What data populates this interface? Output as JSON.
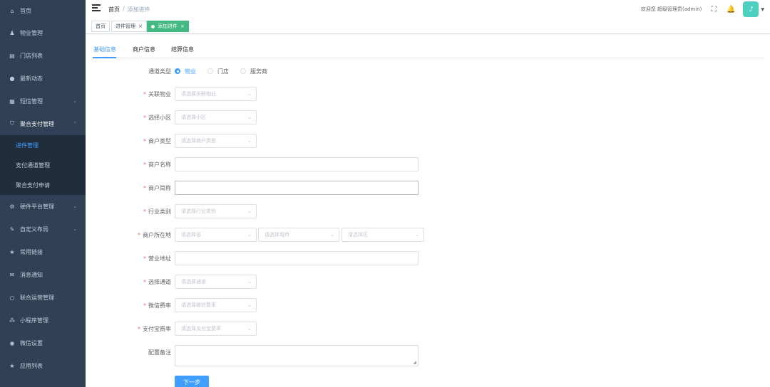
{
  "sidebar": {
    "items": [
      {
        "label": "首页",
        "icon": "dashboard-icon",
        "glyph": "⌂"
      },
      {
        "label": "物业管理",
        "icon": "user-icon",
        "glyph": "♟"
      },
      {
        "label": "门店列表",
        "icon": "store-icon",
        "glyph": "▤"
      },
      {
        "label": "最新动态",
        "icon": "chat-icon",
        "glyph": "●"
      },
      {
        "label": "短信管理",
        "icon": "grid-icon",
        "glyph": "▦"
      },
      {
        "label": "聚合支付管理",
        "icon": "shield-icon",
        "glyph": "⛉"
      },
      {
        "label": "进件管理"
      },
      {
        "label": "支付通道管理"
      },
      {
        "label": "聚合支付申请"
      },
      {
        "label": "硬件平台管理",
        "icon": "gear-icon",
        "glyph": "⚙"
      },
      {
        "label": "自定义布局",
        "icon": "edit-icon",
        "glyph": "✎"
      },
      {
        "label": "常用链接",
        "icon": "star-icon",
        "glyph": "★"
      },
      {
        "label": "消息通知",
        "icon": "message-icon",
        "glyph": "✉"
      },
      {
        "label": "联合运营管理",
        "icon": "bulb-icon",
        "glyph": "○"
      },
      {
        "label": "小程序管理",
        "icon": "cluster-icon",
        "glyph": "⁂"
      },
      {
        "label": "微信设置",
        "icon": "wechat-icon",
        "glyph": "◉"
      },
      {
        "label": "应用列表",
        "icon": "star-icon",
        "glyph": "★"
      }
    ]
  },
  "header": {
    "breadcrumb_home": "首页",
    "breadcrumb_sep": "/",
    "breadcrumb_current": "添加进件",
    "welcome": "欢迎您 超级管理员(admin)",
    "avatar_glyph": "♪",
    "caret": "▼"
  },
  "tags": {
    "home": "首页",
    "jinjian": "进件管理",
    "add": "添加进件",
    "close": "×"
  },
  "tabs": [
    "基础信息",
    "商户信息",
    "结算信息"
  ],
  "form": {
    "channel_type_label": "通道类型",
    "channel_options": [
      "物业",
      "门店",
      "服务商"
    ],
    "related_property_label": "关联物业",
    "related_property_placeholder": "请选择关联物业",
    "community_label": "选择小区",
    "community_placeholder": "请选择小区",
    "merchant_type_label": "商户类型",
    "merchant_type_placeholder": "请选择商户类型",
    "merchant_name_label": "商户名称",
    "merchant_short_label": "商户简称",
    "industry_label": "行业类别",
    "industry_placeholder": "请选择行业类别",
    "location_label": "商户所在地",
    "province_placeholder": "请选择省",
    "city_placeholder": "请选择城市",
    "district_placeholder": "请选择区",
    "address_label": "营业地址",
    "channel_label": "选择通道",
    "channel_placeholder": "请选择通道",
    "wechat_rate_label": "微信费率",
    "wechat_rate_placeholder": "请选择微信费率",
    "alipay_rate_label": "支付宝费率",
    "alipay_rate_placeholder": "请选择支付宝费率",
    "remark_label": "配置备注",
    "next_button": "下一步",
    "required_mark": "*",
    "chevron": "⌄"
  },
  "colors": {
    "sidebar_bg": "#304156",
    "primary": "#409eff",
    "tag_active": "#42b983"
  }
}
